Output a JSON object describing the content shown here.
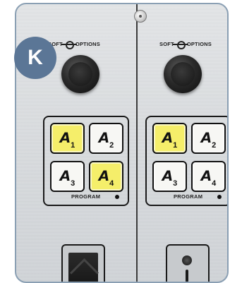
{
  "badge": {
    "label": "K"
  },
  "left_strip": {
    "knob_label_left": "SOFT",
    "knob_label_right": "OPTIONS",
    "buttons": [
      {
        "number": "1",
        "lit": "yellow"
      },
      {
        "number": "2",
        "lit": "white"
      },
      {
        "number": "3",
        "lit": "white"
      },
      {
        "number": "4",
        "lit": "yellow"
      }
    ],
    "group_label": "PROGRAM"
  },
  "right_strip": {
    "knob_label_left": "SOFT",
    "knob_label_right": "OPTIONS",
    "buttons": [
      {
        "number": "1",
        "lit": "yellow"
      },
      {
        "number": "2",
        "lit": "white"
      },
      {
        "number": "3",
        "lit": "white"
      },
      {
        "number": "4",
        "lit": "white"
      }
    ],
    "group_label": "PROGRAM"
  },
  "colors": {
    "panel_border": "#8a9fb3",
    "badge": "#5b7696",
    "button_lit": "#f5ee6a",
    "button_unlit": "#f7f7f4"
  }
}
